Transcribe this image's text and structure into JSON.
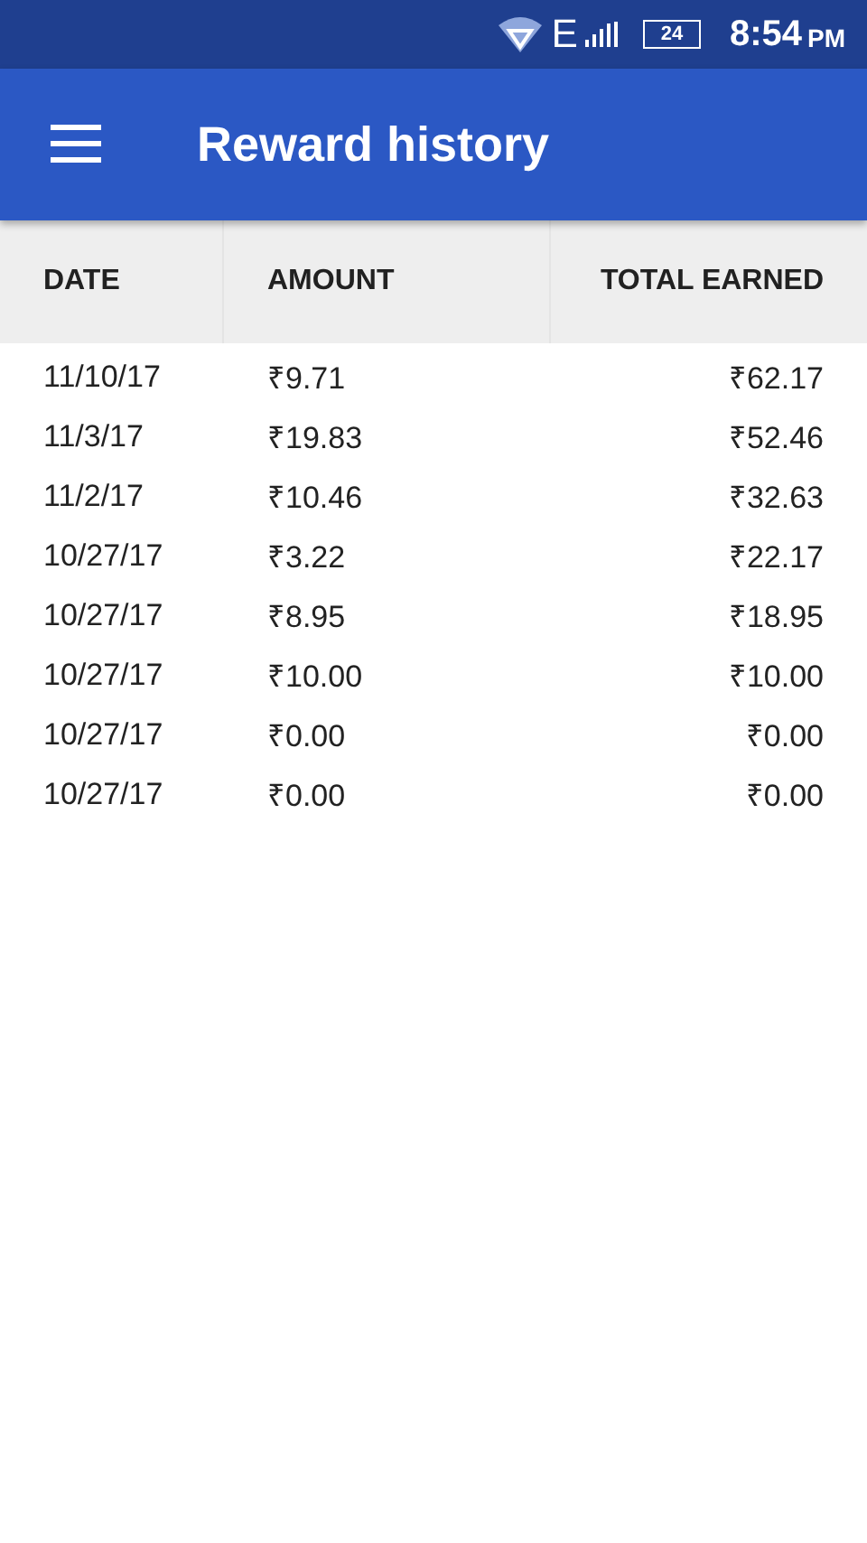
{
  "status_bar": {
    "network": "E",
    "battery": "24",
    "time": "8:54",
    "ampm": "PM"
  },
  "app_bar": {
    "title": "Reward history"
  },
  "table": {
    "columns": [
      "DATE",
      "AMOUNT",
      "TOTAL EARNED"
    ],
    "rows": [
      [
        "11/10/17",
        "₹9.71",
        "₹62.17"
      ],
      [
        "11/3/17",
        "₹19.83",
        "₹52.46"
      ],
      [
        "11/2/17",
        "₹10.46",
        "₹32.63"
      ],
      [
        "10/27/17",
        "₹3.22",
        "₹22.17"
      ],
      [
        "10/27/17",
        "₹8.95",
        "₹18.95"
      ],
      [
        "10/27/17",
        "₹10.00",
        "₹10.00"
      ],
      [
        "10/27/17",
        "₹0.00",
        "₹0.00"
      ],
      [
        "10/27/17",
        "₹0.00",
        "₹0.00"
      ]
    ]
  }
}
